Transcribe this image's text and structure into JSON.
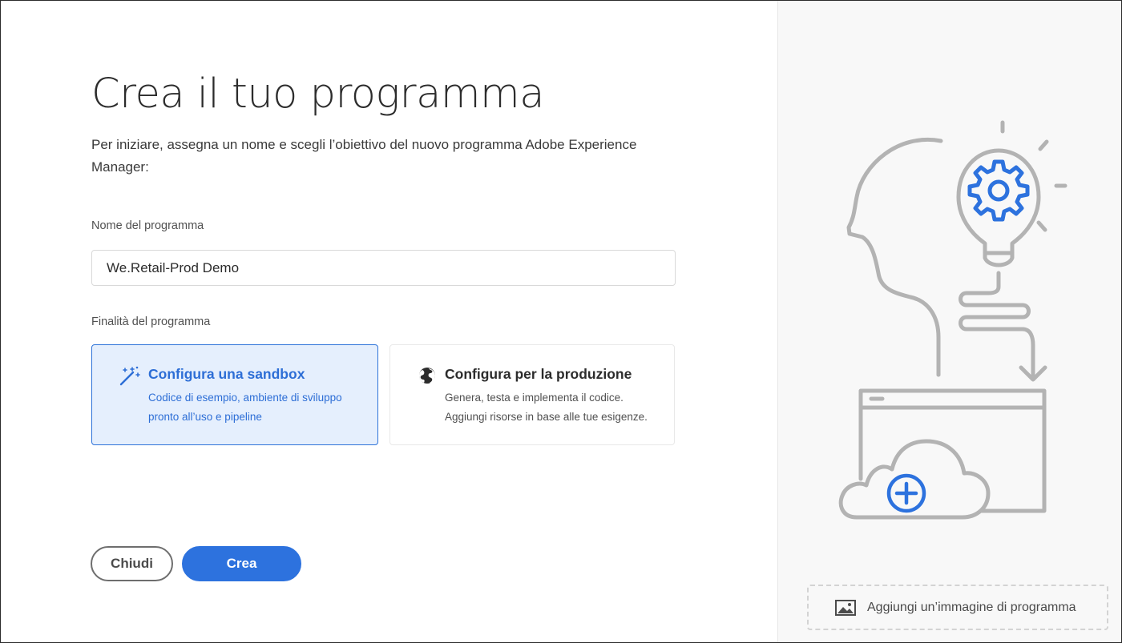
{
  "page": {
    "title": "Crea il tuo programma",
    "intro": "Per iniziare, assegna un nome e scegli l’obiettivo del nuovo programma Adobe Experience Manager:"
  },
  "form": {
    "name_label": "Nome del programma",
    "name_value": "We.Retail-Prod Demo",
    "purpose_label": "Finalità del programma"
  },
  "options": [
    {
      "icon": "magic-wand-icon",
      "title": "Configura una sandbox",
      "description": "Codice di esempio, ambiente di sviluppo pronto all’uso e pipeline",
      "selected": true
    },
    {
      "icon": "globe-icon",
      "title": "Configura per la produzione",
      "description": "Genera, testa e implementa il codice. Aggiungi risorse in base alle tue esigenze.",
      "selected": false
    }
  ],
  "buttons": {
    "close": "Chiudi",
    "create": "Crea"
  },
  "sidebar": {
    "illustration": "head-lightbulb-cloud-illustration",
    "add_image_icon": "image-icon",
    "add_image_label": "Aggiungi un’immagine di programma"
  },
  "colors": {
    "accent": "#2d72de",
    "selected_card_bg": "#e5effd",
    "illustration_gray": "#b3b3b3"
  }
}
